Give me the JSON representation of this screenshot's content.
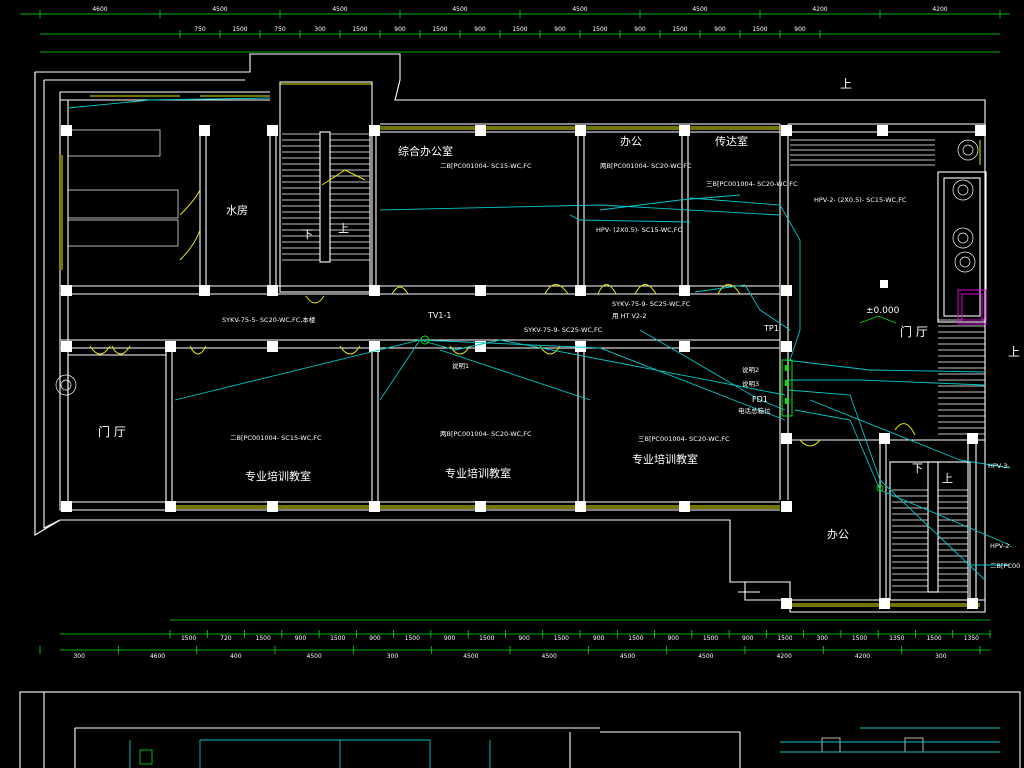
{
  "rooms": {
    "water_room": "水房",
    "general_office": "综合办公室",
    "office_top": "办公",
    "reception": "传达室",
    "lobby_left": "门 厅",
    "lobby_right": "门 厅",
    "classroom_1": "专业培训教室",
    "classroom_2": "专业培训教室",
    "classroom_3": "专业培训教室",
    "office_bottom": "办公"
  },
  "stairs": {
    "down_1": "下",
    "up_1": "上",
    "down_2": "下",
    "up_2": "上"
  },
  "marks": {
    "up_top": "上",
    "up_right": "上",
    "elevation": "±0.000",
    "tv": "TV1-1",
    "tp": "TP1",
    "fd": "FD1",
    "light": "说明1",
    "note_a": "说明2",
    "note_b": "说明3",
    "panel": "电话总箱位"
  },
  "cable_notes": {
    "n1": "二B[PC001004-     SC15-WC,FC",
    "n2": "两B[PC001004-     SC20-WC,FC",
    "n3": "三B[PC001004-     SC20-WC,FC",
    "n4": "HPV- (2X0.5)-     SC15-WC,FC",
    "n5": "HPV-2-     (2X0.5)-     SC15-WC,FC",
    "n6": "SYKV-75-5-     SC20-WC,FC,本楼",
    "n7": "SYKV-75-9-     SC25-WC,FC",
    "n8": "SYKV-75-9-     SC25-WC,FC",
    "n9": "用 HT V2-2",
    "n10": "二B[PC001004-     SC15-WC,FC",
    "n11": "两B[PC001004-     SC20-WC,FC",
    "n12": "三B[PC001004-     SC20-WC,FC",
    "n13": "HPV-3-",
    "n14": "HPV-2-",
    "n15": "二B[PC00"
  },
  "dims_top_outer": [
    "4600",
    "4500",
    "4500",
    "4500",
    "4500",
    "4500",
    "4200",
    "4200"
  ],
  "dims_top_inner": [
    "750",
    "1500",
    "750",
    "300",
    "1500",
    "900",
    "1500",
    "900",
    "1500",
    "900",
    "1500",
    "900",
    "1500",
    "900",
    "1500",
    "900"
  ],
  "dims_bottom_inner": [
    "1500",
    "720",
    "1500",
    "900",
    "1500",
    "900",
    "1500",
    "900",
    "1500",
    "900",
    "1500",
    "900",
    "1500",
    "900",
    "1500",
    "900",
    "1500",
    "300",
    "1500",
    "1350",
    "1500",
    "1350"
  ],
  "dims_bottom_outer": [
    "300",
    "4600",
    "400",
    "4500",
    "300",
    "4500",
    "4500",
    "4500",
    "4500",
    "4200",
    "4200",
    "300"
  ]
}
